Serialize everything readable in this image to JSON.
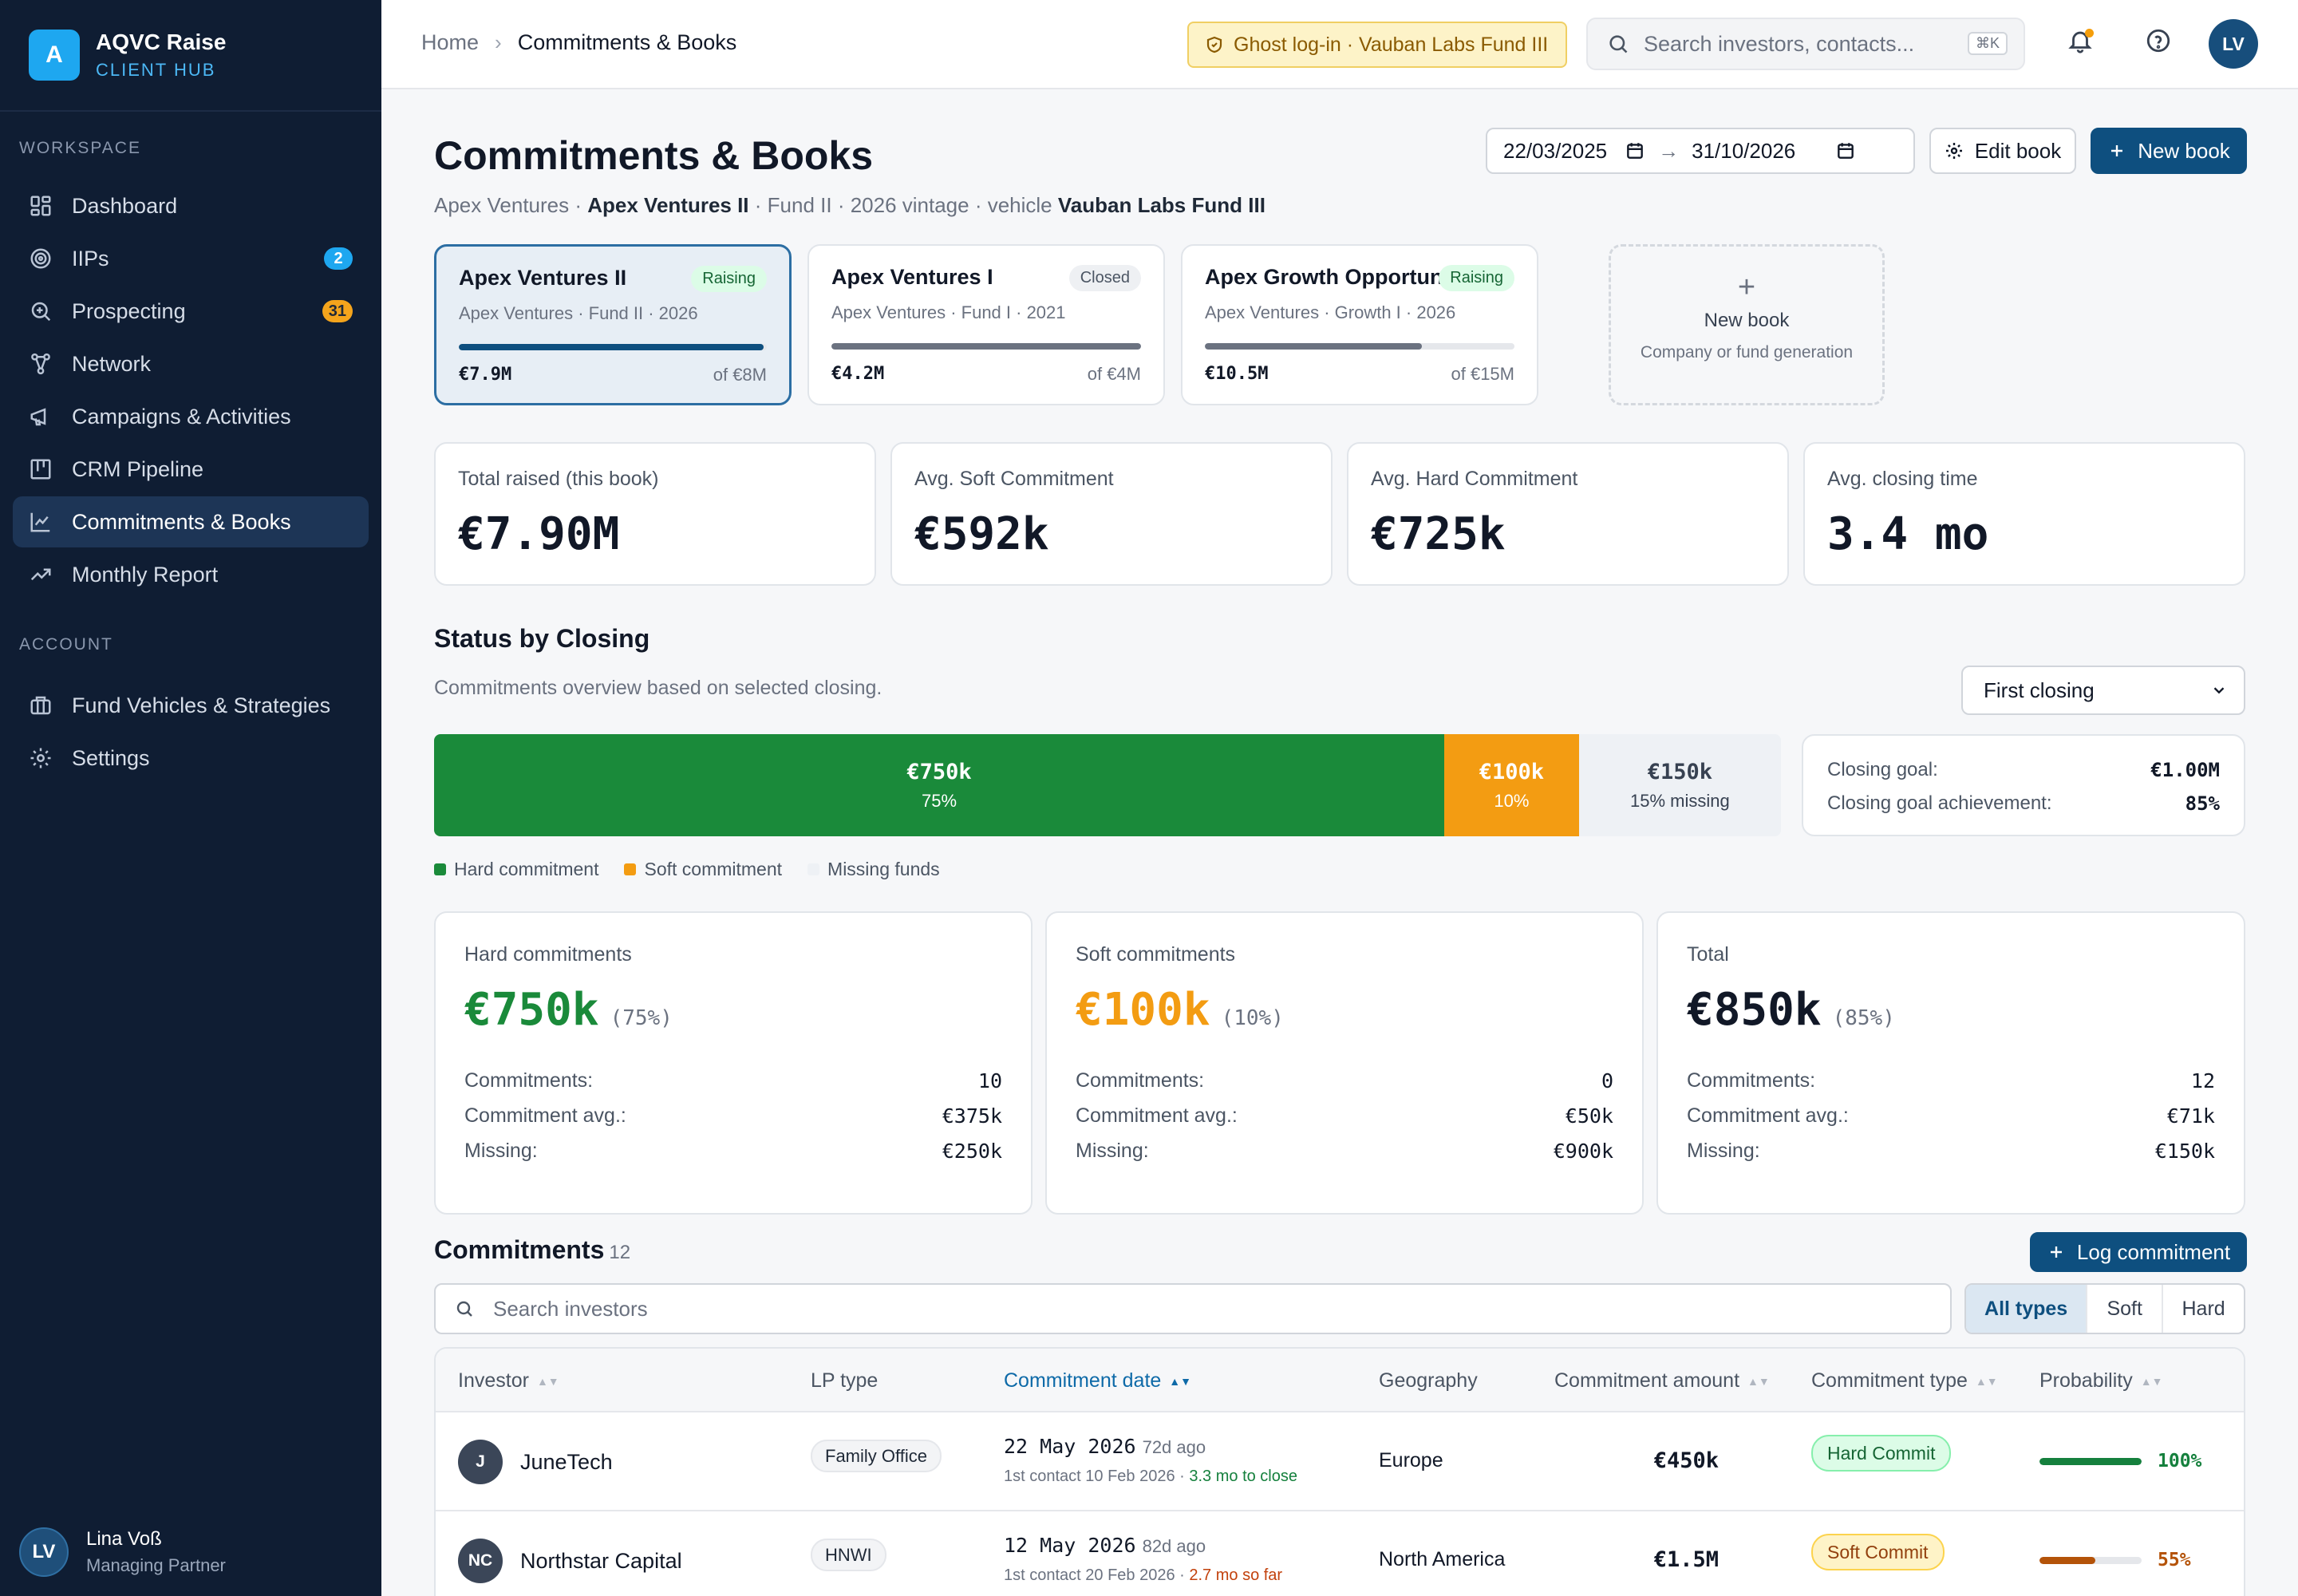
{
  "brand": {
    "logo_letter": "A",
    "name": "AQVC Raise",
    "sub": "CLIENT HUB"
  },
  "sidebar": {
    "workspace_label": "WORKSPACE",
    "account_label": "ACCOUNT",
    "items": [
      {
        "label": "Dashboard",
        "icon": "dashboard-icon"
      },
      {
        "label": "IIPs",
        "icon": "target-icon",
        "badge": "2"
      },
      {
        "label": "Prospecting",
        "icon": "search-plus-icon",
        "badge": "31"
      },
      {
        "label": "Network",
        "icon": "network-icon"
      },
      {
        "label": "Campaigns & Activities",
        "icon": "megaphone-icon"
      },
      {
        "label": "CRM Pipeline",
        "icon": "kanban-icon"
      },
      {
        "label": "Commitments & Books",
        "icon": "line-chart-icon",
        "active": true
      },
      {
        "label": "Monthly Report",
        "icon": "trend-icon"
      }
    ],
    "account_items": [
      {
        "label": "Fund Vehicles & Strategies",
        "icon": "briefcase-icon"
      },
      {
        "label": "Settings",
        "icon": "gear-icon"
      }
    ],
    "user": {
      "initials": "LV",
      "name": "Lina Voß",
      "role": "Managing Partner"
    }
  },
  "topbar": {
    "breadcrumb_home": "Home",
    "breadcrumb_current": "Commitments & Books",
    "ghost_login": "Ghost log-in · Vauban Labs Fund III",
    "search_placeholder": "Search investors, contacts...",
    "search_shortcut": "⌘K",
    "avatar_initials": "LV"
  },
  "page": {
    "title": "Commitments & Books",
    "sub_company": "Apex Ventures",
    "sub_fund": "Apex Ventures II",
    "sub_rest": "· Fund II · 2026 vintage · vehicle",
    "sub_vehicle": "Vauban Labs Fund III",
    "date_from": "22/03/2025",
    "date_to": "31/10/2026",
    "edit_book": "Edit book",
    "new_book": "New book"
  },
  "books": [
    {
      "name": "Apex Ventures II",
      "status": "Raising",
      "sub": "Apex Ventures · Fund II · 2026",
      "raised": "€7.9M",
      "goal": "of €8M",
      "progress": 0.99,
      "color": "#0e4f7f"
    },
    {
      "name": "Apex Ventures I",
      "status": "Closed",
      "sub": "Apex Ventures · Fund I · 2021",
      "raised": "€4.2M",
      "goal": "of €4M",
      "progress": 1.0,
      "color": "#6b7280"
    },
    {
      "name": "Apex Growth Opportunities",
      "status": "Raising",
      "sub": "Apex Ventures · Growth I · 2026",
      "raised": "€10.5M",
      "goal": "of €15M",
      "progress": 0.7,
      "color": "#6b7280"
    }
  ],
  "new_book_card": {
    "plus": "+",
    "title": "New book",
    "sub": "Company or fund generation"
  },
  "kpis": [
    {
      "label": "Total raised (this book)",
      "value": "€7.90M"
    },
    {
      "label": "Avg. Soft Commitment",
      "value": "€592k"
    },
    {
      "label": "Avg. Hard Commitment",
      "value": "€725k"
    },
    {
      "label": "Avg. closing time",
      "value": "3.4 mo"
    }
  ],
  "status": {
    "title": "Status by Closing",
    "sub": "Commitments overview based on selected closing.",
    "closing_selected": "First closing",
    "segments": [
      {
        "amount": "€750k",
        "pct_label": "75%",
        "share": 0.75,
        "color": "#1a8a3a"
      },
      {
        "amount": "€100k",
        "pct_label": "10%",
        "share": 0.1,
        "color": "#f39c12"
      },
      {
        "amount": "€150k",
        "pct_label": "15% missing",
        "share": 0.15,
        "color": "#eef1f5"
      }
    ],
    "goal_label": "Closing goal:",
    "goal_value": "€1.00M",
    "achievement_label": "Closing goal achievement:",
    "achievement_value": "85%",
    "legend": [
      {
        "label": "Hard commitment",
        "color": "#1a8a3a"
      },
      {
        "label": "Soft commitment",
        "color": "#f39c12"
      },
      {
        "label": "Missing funds",
        "color": "#eef1f5"
      }
    ]
  },
  "summaries": [
    {
      "label": "Hard commitments",
      "amount": "€750k",
      "pct": "(75%)",
      "color": "#1a8a3a",
      "rows": [
        [
          "Commitments:",
          "10"
        ],
        [
          "Commitment avg.:",
          "€375k"
        ],
        [
          "Missing:",
          "€250k"
        ]
      ]
    },
    {
      "label": "Soft commitments",
      "amount": "€100k",
      "pct": "(10%)",
      "color": "#f39c12",
      "rows": [
        [
          "Commitments:",
          "0"
        ],
        [
          "Commitment avg.:",
          "€50k"
        ],
        [
          "Missing:",
          "€900k"
        ]
      ]
    },
    {
      "label": "Total",
      "amount": "€850k",
      "pct": "(85%)",
      "color": "#111827",
      "rows": [
        [
          "Commitments:",
          "12"
        ],
        [
          "Commitment avg.:",
          "€71k"
        ],
        [
          "Missing:",
          "€150k"
        ]
      ]
    }
  ],
  "commitments": {
    "title": "Commitments",
    "count": "12",
    "log_button": "Log commitment",
    "search_placeholder": "Search investors",
    "filters": [
      "All types",
      "Soft",
      "Hard"
    ],
    "columns": [
      "Investor",
      "LP type",
      "Commitment date",
      "Geography",
      "Commitment amount",
      "Commitment type",
      "Probability"
    ],
    "rows": [
      {
        "initials": "J",
        "investor": "JuneTech",
        "lp_type": "Family Office",
        "date": "22 May 2026",
        "ago": "72d ago",
        "contact": "1st contact 10 Feb 2026 ·",
        "closing_note": "3.3 mo to close",
        "note_color": "#15803d",
        "geography": "Europe",
        "amount": "€450k",
        "type": "Hard Commit",
        "probability": 1.0,
        "prob_label": "100%",
        "prob_color": "#15803d"
      },
      {
        "initials": "NC",
        "investor": "Northstar Capital",
        "lp_type": "HNWI",
        "date": "12 May 2026",
        "ago": "82d ago",
        "contact": "1st contact 20 Feb 2026 ·",
        "closing_note": "2.7 mo so far",
        "note_color": "#c2410c",
        "geography": "North America",
        "amount": "€1.5M",
        "type": "Soft Commit",
        "probability": 0.55,
        "prob_label": "55%",
        "prob_color": "#b45309"
      }
    ]
  }
}
